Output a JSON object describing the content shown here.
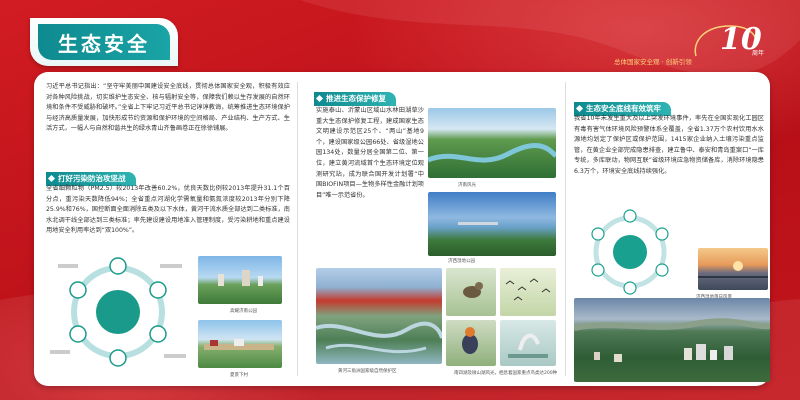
{
  "header": {
    "title": "生态安全",
    "slogan": "总体国家安全观 · 创新引领",
    "anniversary_number": "10",
    "anniversary_suffix": "周年"
  },
  "colors": {
    "primary_red": "#c8141c",
    "teal": "#0e8a8f",
    "gold": "#ffd27a"
  },
  "col1": {
    "intro": "习近平总书记指出：“坚守牢美丽中国建设安全底线，贯彻总体国家安全观，积极有效应对各种风险挑战，切实维护生态安全、核与辐射安全等，保障我们赖以生存发展的自然环境和条件不受威胁和破坏。”全省上下牢记习近平总书记谆谆教诲，统筹推进生态环境保护与经济高质量发展，加快形成节约资源和保护环境的空间格局、产业结构、生产方式、生活方式，一幅人与自然和谐共生的绿水青山齐鲁画卷正在徐徐铺展。",
    "section_title": "打好污染防治攻坚战",
    "section_text": "全省细颗粒物（PM2.5）较2013年改善60.2%，优良天数比例较2013年提升31.1个百分点，重污染天数降低94%；全省重点河湖化学需氧量和氨氮浓度较2013年分别下降25.9%和76%，国控断面全面消除五类及以下水体，黄河干流水质全部达到二类标准，南水北调干线全部达到三类标准；率先建设建设用地准入管理制度，受污染耕地和重点建设用地安全利用率达到“双100%”。",
    "caption_a": "高耀济南公园",
    "caption_b": "夏景下村"
  },
  "col2": {
    "section_title": "推进生态保护修复",
    "text": "实施泰山、沂蒙山区域山水林田湖草沙重大生态保护修复工程，建成国家生态文明建设示范区25个、“两山”基地9个，建设国家级公园66处、省级湿地公园134处，数量分居全国第二位、第一位，建立黄河流域首个生态环境定位观测研究站，成为联合国开发计划署“中国BIOFIN项目—生物多样性金融计划项目”唯一示范省份。",
    "caption_a": "济南风光",
    "caption_b": "济西湿地公园",
    "caption_c": "黄河三角洲国家级自然保护区",
    "caption_d": "南四湖及微山湖风光，栖息着国家重点鸟类达200种"
  },
  "col3": {
    "section_title": "生态安全底线有效筑牢",
    "text": "我省10年未发生重大及以上突发环境事件，率先在全国实现化工园区有毒有害气体环境风险预警体系全覆盖，全省1.37万个农村饮用水水源地均划定了保护区或保护范围，1415家企业纳入土壤污染重点监管，在黄企业全部完成隐患排查，建立鲁中、泰安和青岛重案口“一库专统，多库联动，物网互联”省级环境应急物资储备库，消除环境隐患6.3万个，环境安全底线持续强化。",
    "caption_a": "济西湿地落日风景"
  }
}
